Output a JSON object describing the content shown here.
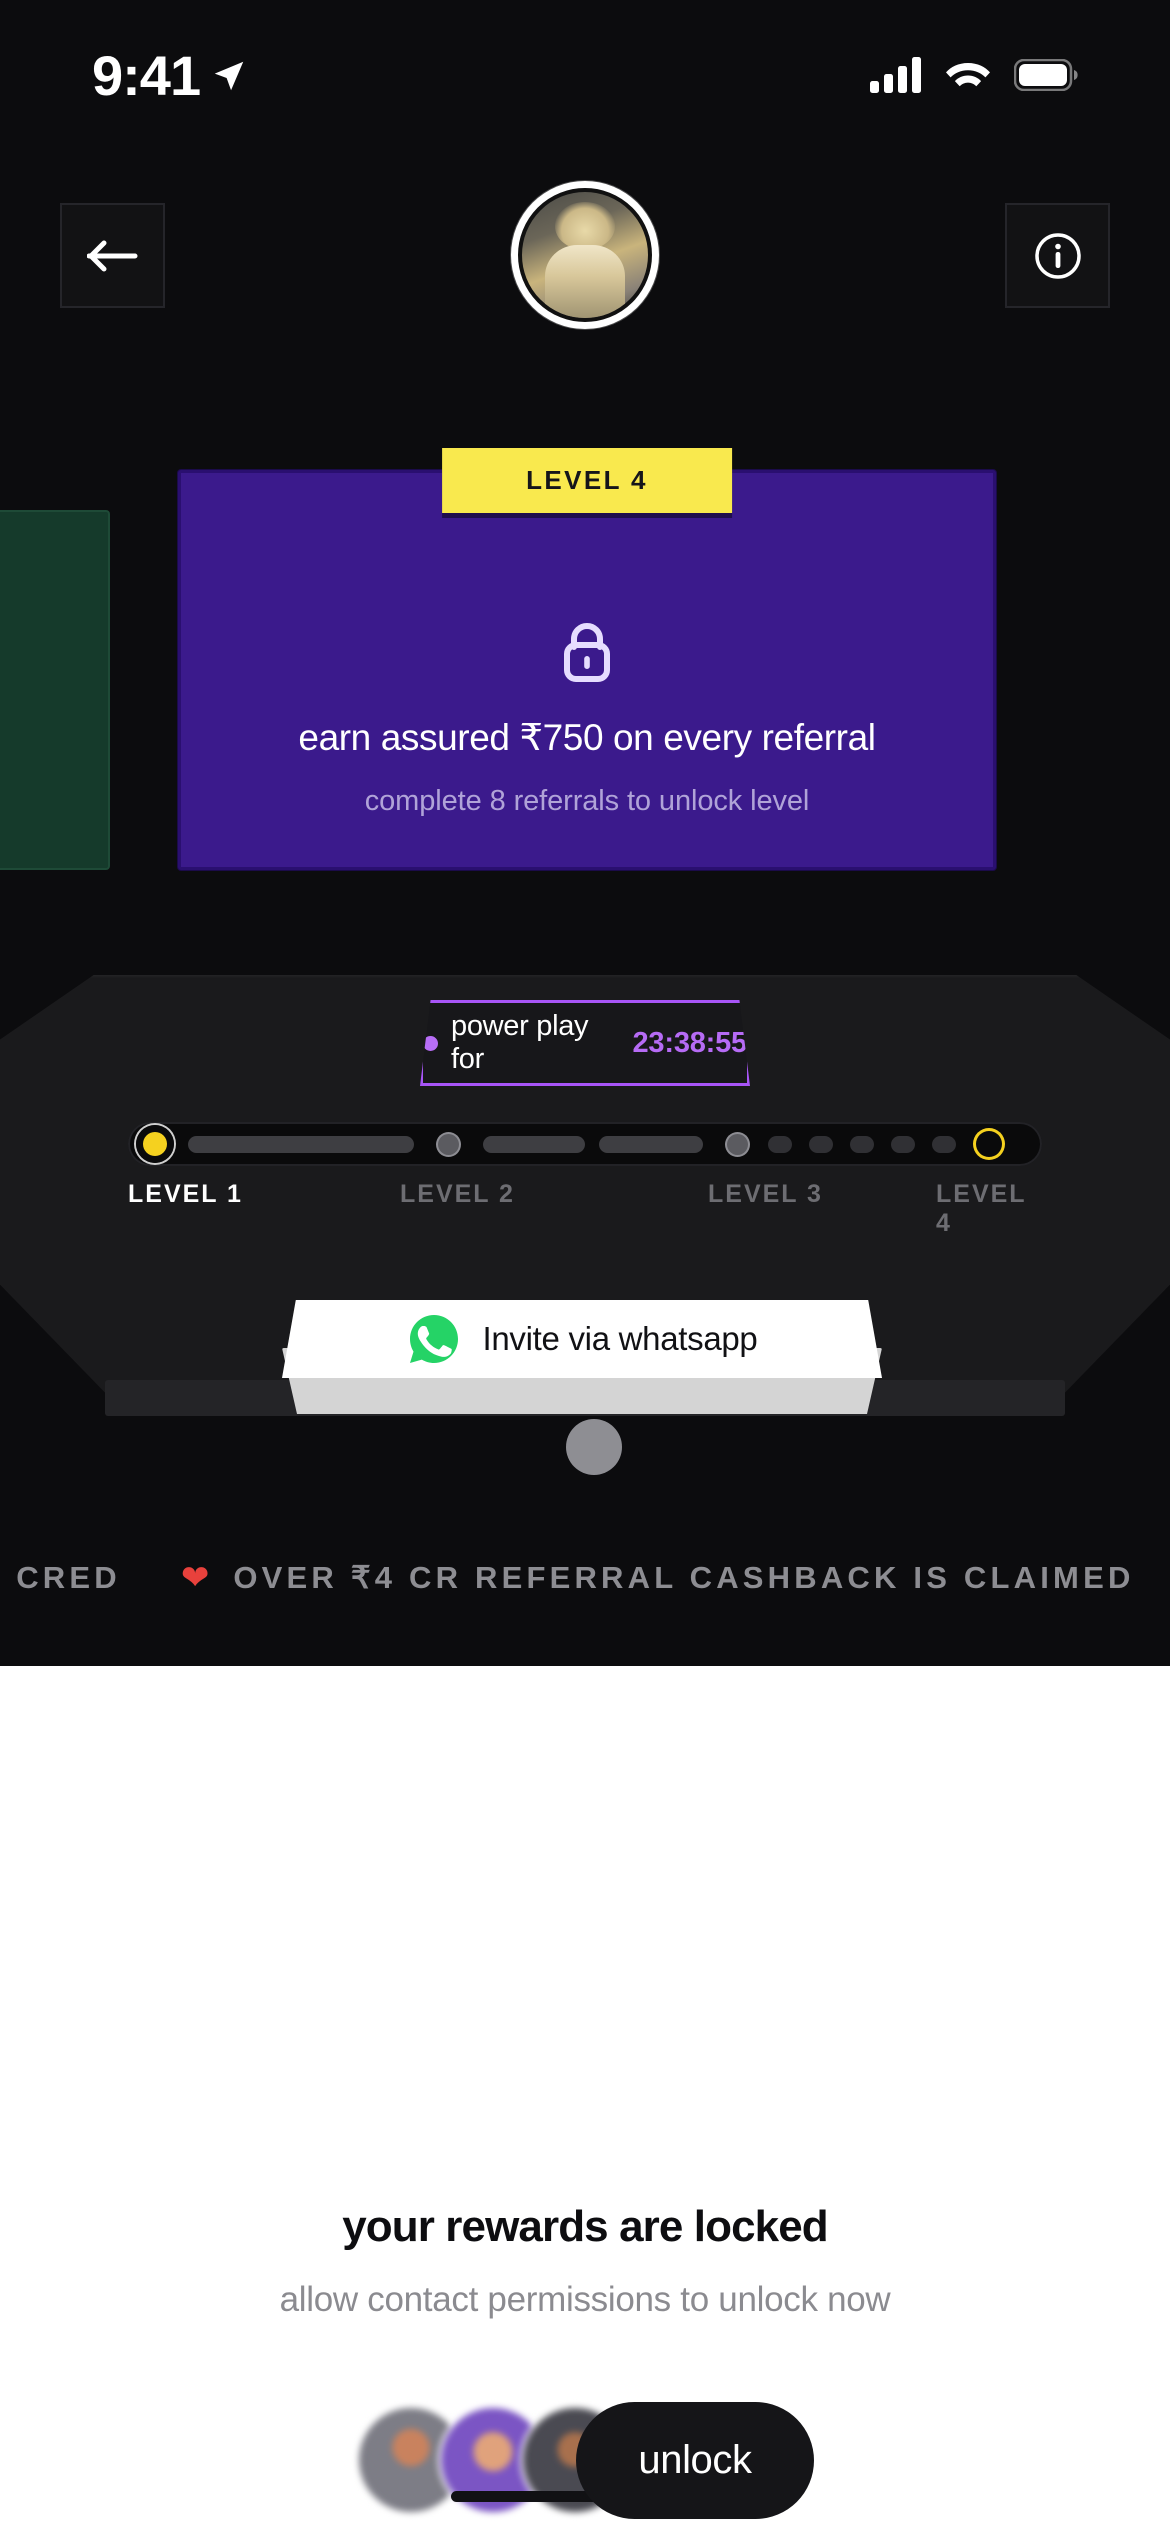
{
  "status_bar": {
    "time": "9:41",
    "location_icon": "location-arrow-icon",
    "cellular_icon": "cellular-signal-icon",
    "wifi_icon": "wifi-icon",
    "battery_icon": "battery-full-icon"
  },
  "nav": {
    "back_icon": "arrow-left-icon",
    "info_icon": "info-circle-icon",
    "avatar": "profile-avatar"
  },
  "level_card": {
    "badge": "LEVEL 4",
    "lock_icon": "lock-icon",
    "title": "earn assured ₹750 on every referral",
    "subtitle": "complete 8 referrals to unlock level",
    "bg_color": "#3b1a8c",
    "badge_color": "#f9e94e"
  },
  "power_play": {
    "label": "power play for",
    "timer": "23:38:55",
    "accent_color": "#a855f7"
  },
  "progress": {
    "levels": [
      {
        "label": "LEVEL 1",
        "active": true
      },
      {
        "label": "LEVEL 2",
        "active": false
      },
      {
        "label": "LEVEL 3",
        "active": false
      },
      {
        "label": "LEVEL 4",
        "active": false
      }
    ],
    "start_node_color": "#f5d11f",
    "end_node_color": "#f5d11f"
  },
  "invite_button": {
    "label": "Invite via whatsapp",
    "icon": "whatsapp-icon",
    "icon_color": "#25d366"
  },
  "marquee": {
    "left_text": "IN CRED",
    "heart_icon": "heart-icon",
    "text": "OVER ₹4 CR REFERRAL CASHBACK IS CLAIMED",
    "heart_color": "#e8413c"
  },
  "sheet": {
    "title": "your rewards are locked",
    "subtitle": "allow contact permissions to unlock now",
    "unlock_label": "unlock",
    "avatars": [
      "contact-avatar-1",
      "contact-avatar-2",
      "contact-avatar-3"
    ]
  }
}
